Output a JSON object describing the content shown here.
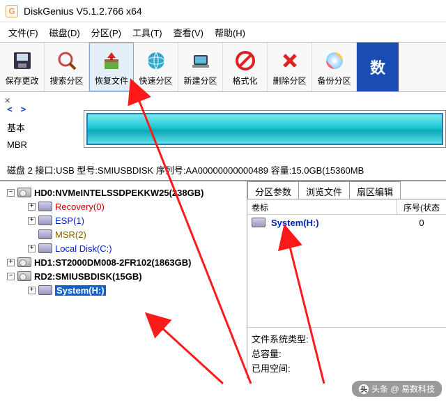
{
  "title": "DiskGenius V5.1.2.766 x64",
  "menu": {
    "file": "文件(F)",
    "disk": "磁盘(D)",
    "part": "分区(P)",
    "tool": "工具(T)",
    "view": "查看(V)",
    "help": "帮助(H)"
  },
  "toolbar": {
    "save": "保存更改",
    "search": "搜索分区",
    "recover": "恢复文件",
    "quick": "快速分区",
    "newp": "新建分区",
    "format": "格式化",
    "delp": "删除分区",
    "backup": "备份分区",
    "promo": "数"
  },
  "diskinfo": {
    "basic": "基本",
    "mbr": "MBR",
    "line": "磁盘 2 接口:USB 型号:SMIUSBDISK 序列号:AA00000000000489 容量:15.0GB(15360MB"
  },
  "tree": {
    "hd0": "HD0:NVMeINTELSSDPEKKW25(238GB)",
    "rec": "Recovery(0)",
    "esp": "ESP(1)",
    "msr": "MSR(2)",
    "local": "Local Disk(C:)",
    "hd1": "HD1:ST2000DM008-2FR102(1863GB)",
    "rd2": "RD2:SMIUSBDISK(15GB)",
    "sys": "System(H:)"
  },
  "tabs": {
    "param": "分区参数",
    "browse": "浏览文件",
    "sector": "扇区编辑"
  },
  "rhead": {
    "label": "卷标",
    "serial": "序号(状态"
  },
  "rrow": {
    "name": "System(H:)",
    "serial": "0"
  },
  "stats": {
    "fs": "文件系统类型:",
    "total": "总容量:",
    "used": "已用空间:"
  },
  "watermark": "头条 @ 易数科技"
}
